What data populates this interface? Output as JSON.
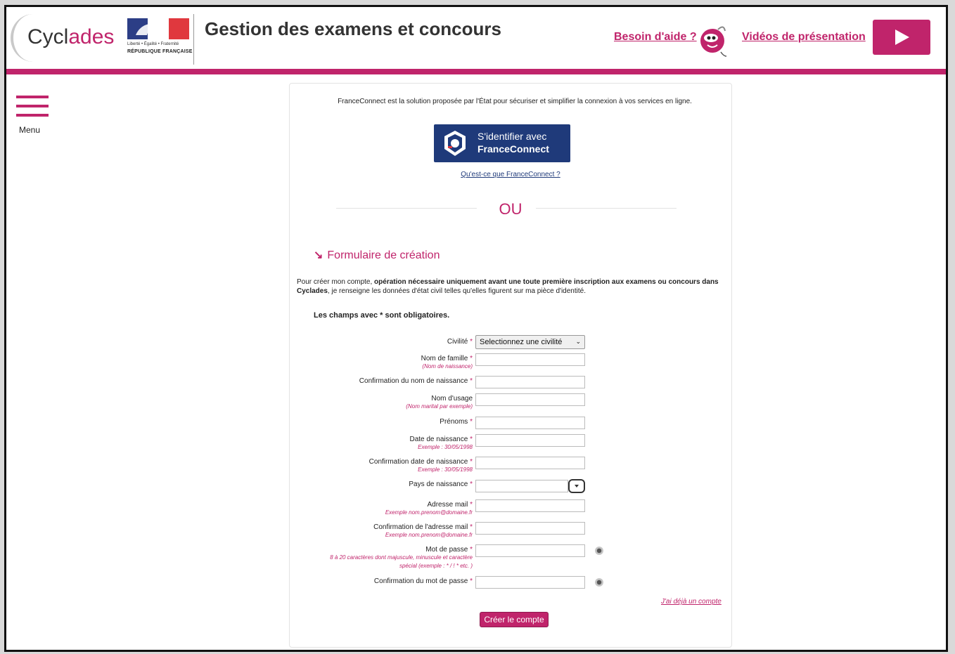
{
  "header": {
    "logo_part1": "Cycl",
    "logo_part2": "ades",
    "marianne_motto": "Liberté • Égalité • Fraternité",
    "marianne_republic": "RÉPUBLIQUE FRANÇAISE",
    "app_title": "Gestion des examens et concours",
    "help_link": "Besoin d'aide ?",
    "video_link": "Vidéos de présentation"
  },
  "menu": {
    "label": "Menu"
  },
  "franceconnect": {
    "intro": "FranceConnect est la solution proposée par l'État pour sécuriser et simplifier la connexion à vos services en ligne.",
    "button_line1": "S'identifier avec",
    "button_line2": "FranceConnect",
    "what_link": "Qu'est-ce que FranceConnect ?"
  },
  "separator": "OU",
  "form": {
    "title": "Formulaire de création",
    "description_bold": "Pour créer mon compte, opération nécessaire uniquement avant une toute première inscription aux examens ou concours dans Cyclades,",
    "description_rest": " je renseigne les données d'état civil telles qu'elles figurent sur ma pièce d'identité.",
    "description_lead": "Pour créer mon compte, ",
    "description_bold_part": "opération nécessaire uniquement avant une toute première inscription aux examens ou concours dans Cyclades",
    "required_note": "Les champs avec * sont obligatoires.",
    "star": "*",
    "fields": {
      "civilite": {
        "label": "Civilité",
        "value": "Selectionnez une civilité"
      },
      "nom_famille": {
        "label": "Nom de famille",
        "hint": "(Nom de naissance)"
      },
      "conf_nom": {
        "label": "Confirmation du nom de naissance"
      },
      "nom_usage": {
        "label": "Nom d'usage",
        "hint": "(Nom marital par exemple)"
      },
      "prenoms": {
        "label": "Prénoms"
      },
      "date_naissance": {
        "label": "Date de naissance",
        "hint": "Exemple : 30/05/1998"
      },
      "conf_date": {
        "label": "Confirmation date de naissance",
        "hint": "Exemple : 30/05/1998"
      },
      "pays": {
        "label": "Pays de naissance"
      },
      "mail": {
        "label": "Adresse mail",
        "hint": "Exemple nom.prenom@domaine.fr"
      },
      "conf_mail": {
        "label": "Confirmation de l'adresse mail",
        "hint": "Exemple nom.prenom@domaine.fr"
      },
      "mdp": {
        "label": "Mot de passe",
        "hint1": "8 à 20 caractères dont majuscule, minuscule et caractère",
        "hint2": "spécial (exemple : * / ! * etc. )"
      },
      "conf_mdp": {
        "label": "Confirmation du mot de passe"
      }
    },
    "already_link": "J'ai déjà un compte",
    "submit": "Créer le compte"
  },
  "colors": {
    "accent": "#c0246b",
    "franceconnect_blue": "#1f3a7a"
  },
  "icons": [
    "menu-icon",
    "help-character-icon",
    "play-icon",
    "franceconnect-logo-icon",
    "dropdown-chevron-icon",
    "password-eye-icon"
  ]
}
